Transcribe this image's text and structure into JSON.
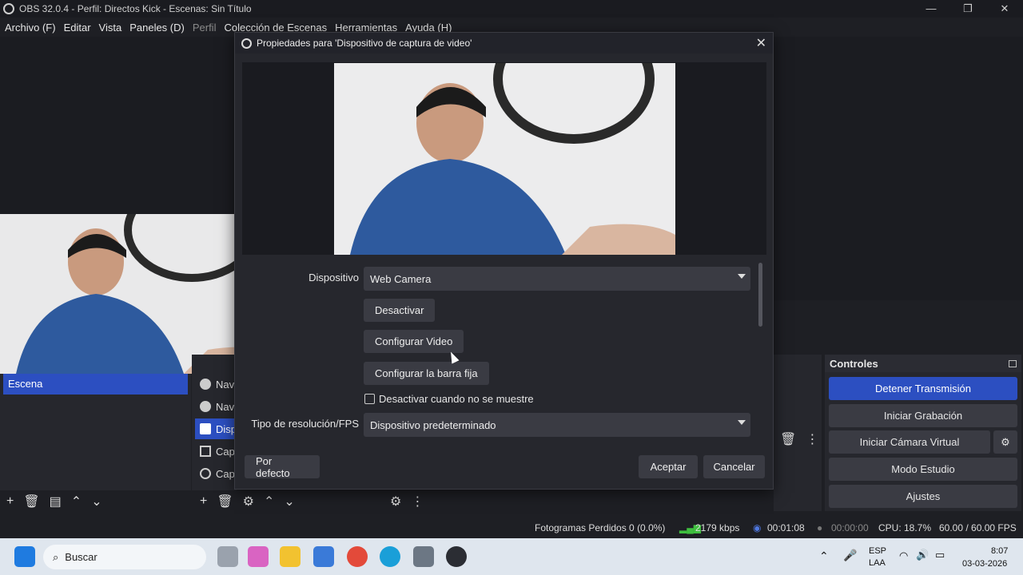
{
  "window": {
    "title": "OBS 32.0.4 - Perfil: Directos Kick - Escenas: Sin Título",
    "minimize": "—",
    "maximize": "❐",
    "close": "✕"
  },
  "menu": {
    "items": [
      "Archivo (F)",
      "Editar",
      "Vista",
      "Paneles (D)",
      "Perfil",
      "Colección de Escenas",
      "Herramientas",
      "Ayuda (H)"
    ]
  },
  "scenes": {
    "items": [
      "Escena"
    ]
  },
  "sources": {
    "items": [
      "Nav",
      "Nav",
      "Disp",
      "Cap",
      "Cap"
    ]
  },
  "controls": {
    "title": "Controles",
    "stop_stream": "Detener Transmisión",
    "start_recording": "Iniciar Grabación",
    "start_virtual_cam": "Iniciar Cámara Virtual",
    "studio_mode": "Modo Estudio",
    "settings": "Ajustes"
  },
  "status": {
    "dropped_frames": "Fotogramas Perdidos 0 (0.0%)",
    "bitrate": "2179 kbps",
    "stream_time": "00:01:08",
    "rec_time": "00:00:00",
    "cpu": "CPU: 18.7%",
    "fps": "60.00 / 60.00 FPS"
  },
  "dialog": {
    "title": "Propiedades para 'Dispositivo de captura de video'",
    "device_label": "Dispositivo",
    "device_value": "Web Camera",
    "deactivate": "Desactivar",
    "configure_video": "Configurar Video",
    "configure_crossbar": "Configurar la barra fija",
    "deactivate_hidden": "Desactivar cuando no se muestre",
    "resolution_label": "Tipo de resolución/FPS",
    "resolution_value": "Dispositivo predeterminado",
    "defaults": "Por defecto",
    "accept": "Aceptar",
    "cancel": "Cancelar"
  },
  "taskbar": {
    "search": "Buscar",
    "lang_top": "ESP",
    "lang_bottom": "LAA",
    "time": "8:07",
    "date": "03-03-2026"
  }
}
